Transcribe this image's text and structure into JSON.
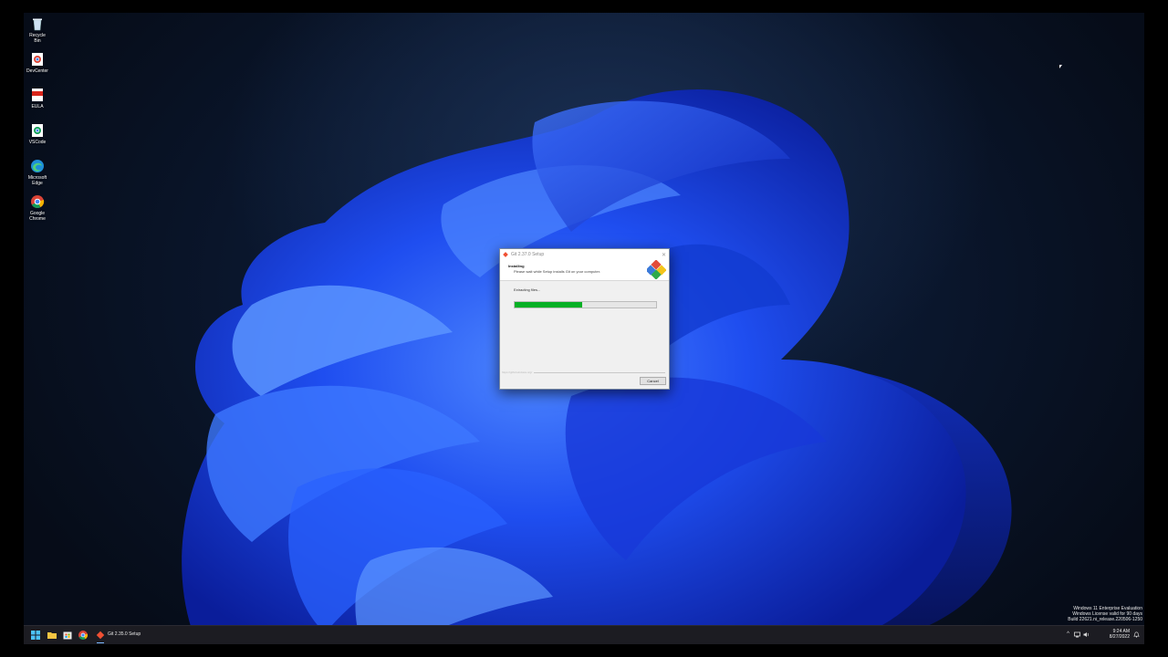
{
  "desktop": {
    "icons": [
      {
        "label": "Recycle Bin",
        "icon": "recycle-bin-icon"
      },
      {
        "label": "DevCenter",
        "icon": "chrome-icon"
      },
      {
        "label": "EULA",
        "icon": "pdf-icon"
      },
      {
        "label": "VSCode",
        "icon": "chrome-icon"
      },
      {
        "label": "Microsoft Edge",
        "icon": "edge-icon"
      },
      {
        "label": "Google Chrome",
        "icon": "chrome-icon"
      }
    ]
  },
  "dialog": {
    "title": "Git 2.37.0 Setup",
    "heading": "Installing",
    "subheading": "Please wait while Setup installs Git on your computer.",
    "status": "Extracting files...",
    "progress": 0.48,
    "brand": "https://gitforwindows.org/",
    "cancel_label": "Cancel",
    "close_glyph": "✕"
  },
  "watermark": {
    "line1": "Windows 11 Enterprise Evaluation",
    "line2": "Windows License valid for 90 days",
    "line3": "Build 22621.ni_release.220506-1250"
  },
  "taskbar": {
    "active_app_label": "Git 2.35.0 Setup",
    "time": "9:24 AM",
    "date": "8/27/2022",
    "tray_chevron": "^"
  },
  "colors": {
    "progress_fill": "#06b025",
    "taskbar_bg": "#1c1c22",
    "desktop_bg": "#0a162c",
    "bloom_blue": "#1f4ef0"
  }
}
